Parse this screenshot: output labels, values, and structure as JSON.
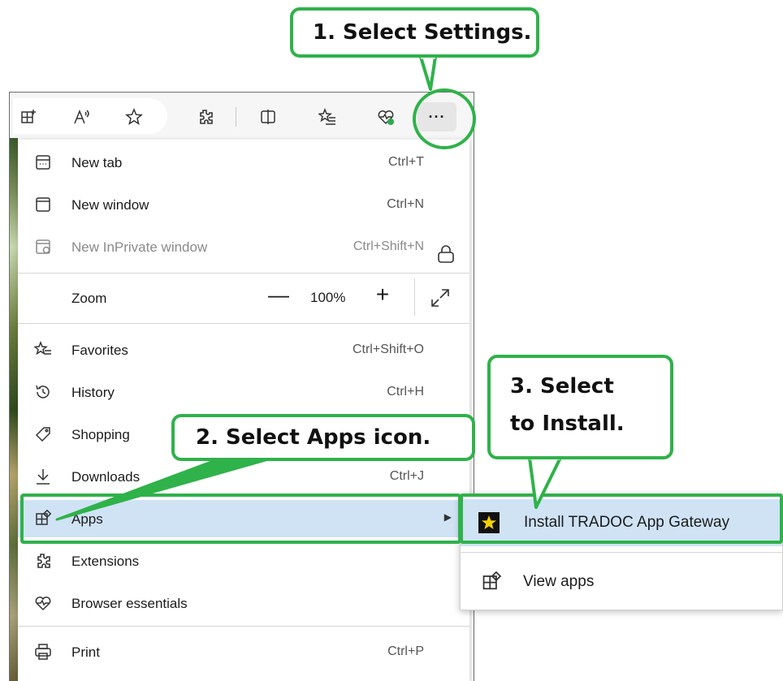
{
  "callouts": {
    "step1": "1. Select Settings.",
    "step2": "2. Select Apps icon.",
    "step3_line1": "3. Select",
    "step3_line2": "to Install."
  },
  "toolbar": {
    "icons": [
      "split-screen-add-icon",
      "read-aloud-icon",
      "favorite-star-icon",
      "extensions-icon",
      "split-screen-icon",
      "favorites-icon",
      "browser-essentials-icon",
      "settings-more-icon"
    ],
    "settings_label": "···"
  },
  "menu": {
    "items": [
      {
        "label": "New tab",
        "shortcut": "Ctrl+T",
        "icon": "new-tab-icon"
      },
      {
        "label": "New window",
        "shortcut": "Ctrl+N",
        "icon": "new-window-icon"
      },
      {
        "label": "New InPrivate window",
        "shortcut": "Ctrl+Shift+N",
        "icon": "inprivate-icon"
      },
      {
        "label": "Zoom",
        "shortcut": "",
        "icon": ""
      },
      {
        "label": "Favorites",
        "shortcut": "Ctrl+Shift+O",
        "icon": "favorites-icon"
      },
      {
        "label": "History",
        "shortcut": "Ctrl+H",
        "icon": "history-icon"
      },
      {
        "label": "Shopping",
        "shortcut": "",
        "icon": "shopping-tag-icon"
      },
      {
        "label": "Downloads",
        "shortcut": "Ctrl+J",
        "icon": "download-icon"
      },
      {
        "label": "Apps",
        "shortcut": "",
        "icon": "apps-icon"
      },
      {
        "label": "Extensions",
        "shortcut": "",
        "icon": "extensions-icon"
      },
      {
        "label": "Browser essentials",
        "shortcut": "",
        "icon": "heart-pulse-icon"
      },
      {
        "label": "Print",
        "shortcut": "Ctrl+P",
        "icon": "printer-icon"
      }
    ],
    "zoom": {
      "minus": "—",
      "value": "100%",
      "plus": "+"
    }
  },
  "submenu": {
    "install_label": "Install TRADOC App Gateway",
    "view_apps_label": "View apps"
  },
  "colors": {
    "callout_border": "#2fb24a",
    "highlight_bg": "#cfe3f5"
  }
}
